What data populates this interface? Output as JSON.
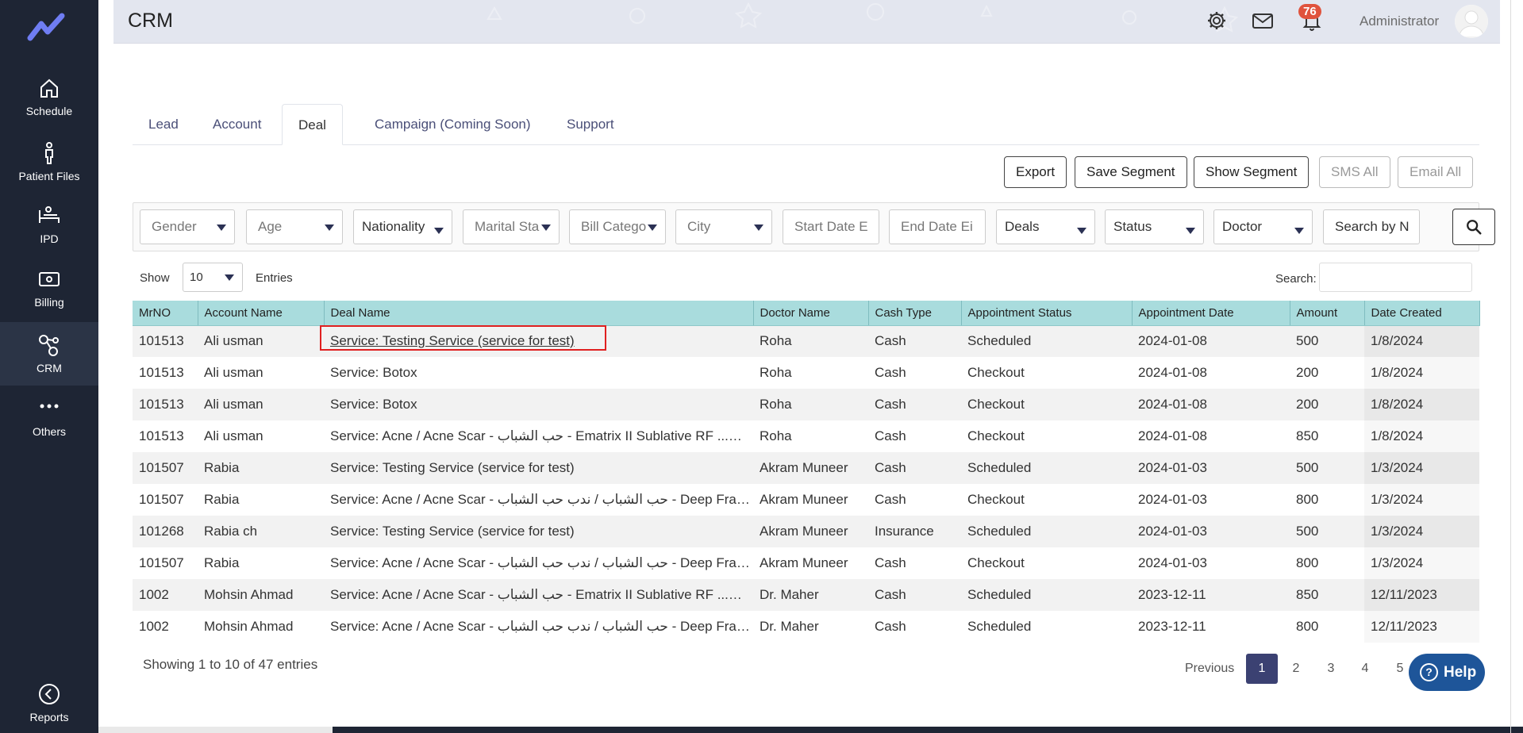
{
  "sidebar": {
    "items": [
      {
        "label": "Schedule",
        "icon": "home-icon"
      },
      {
        "label": "Patient Files",
        "icon": "patient-icon"
      },
      {
        "label": "IPD",
        "icon": "bed-icon"
      },
      {
        "label": "Billing",
        "icon": "money-icon"
      },
      {
        "label": "CRM",
        "icon": "crm-icon",
        "active": true
      },
      {
        "label": "Others",
        "icon": "more-icon"
      },
      {
        "label": "Reports",
        "icon": "reports-icon"
      }
    ]
  },
  "header": {
    "title": "CRM",
    "notification_count": "76",
    "user": "Administrator"
  },
  "tabs": [
    "Lead",
    "Account",
    "Deal",
    "Campaign (Coming Soon)",
    "Support"
  ],
  "active_tab": "Deal",
  "actions": {
    "export": "Export",
    "save_segment": "Save Segment",
    "show_segment": "Show Segment",
    "sms_all": "SMS All",
    "email_all": "Email All"
  },
  "filters": {
    "gender": "Gender",
    "age": "Age",
    "nationality": "Nationality",
    "marital_status": "Marital Sta",
    "bill_category": "Bill Catego",
    "city": "City",
    "start_date": "Start Date E",
    "end_date": "End Date Ei",
    "deals": "Deals",
    "status": "Status",
    "doctor": "Doctor",
    "search_placeholder": "Search by N"
  },
  "list_controls": {
    "show_label": "Show",
    "page_size": "10",
    "entries_label": "Entries",
    "search_label": "Search:"
  },
  "table": {
    "columns": [
      "MrNO",
      "Account Name",
      "Deal Name",
      "Doctor Name",
      "Cash Type",
      "Appointment Status",
      "Appointment Date",
      "Amount",
      "Date Created"
    ],
    "rows": [
      [
        "101513",
        "Ali usman",
        "Service: Testing Service (service for test)",
        "Roha",
        "Cash",
        "Scheduled",
        "2024-01-08",
        "500",
        "1/8/2024"
      ],
      [
        "101513",
        "Ali usman",
        "Service: Botox",
        "Roha",
        "Cash",
        "Checkout",
        "2024-01-08",
        "200",
        "1/8/2024"
      ],
      [
        "101513",
        "Ali usman",
        "Service: Botox",
        "Roha",
        "Cash",
        "Checkout",
        "2024-01-08",
        "200",
        "1/8/2024"
      ],
      [
        "101513",
        "Ali usman",
        "Service: Acne / Acne Scar - حب الشباب - Ematrix II Sublative RF ...طحي",
        "Roha",
        "Cash",
        "Checkout",
        "2024-01-08",
        "850",
        "1/8/2024"
      ],
      [
        "101507",
        "Rabia",
        "Service: Testing Service (service for test)",
        "Akram Muneer",
        "Cash",
        "Scheduled",
        "2024-01-03",
        "500",
        "1/3/2024"
      ],
      [
        "101507",
        "Rabia",
        "Service: Acne / Acne Scar - حب الشباب / ندب حب الشباب - Deep Fraction...",
        "Akram Muneer",
        "Cash",
        "Checkout",
        "2024-01-03",
        "800",
        "1/3/2024"
      ],
      [
        "101268",
        "Rabia ch",
        "Service: Testing Service (service for test)",
        "Akram Muneer",
        "Insurance",
        "Scheduled",
        "2024-01-03",
        "500",
        "1/3/2024"
      ],
      [
        "101507",
        "Rabia",
        "Service: Acne / Acne Scar - حب الشباب / ندب حب الشباب - Deep Fraction...",
        "Akram Muneer",
        "Cash",
        "Checkout",
        "2024-01-03",
        "800",
        "1/3/2024"
      ],
      [
        "1002",
        "Mohsin Ahmad",
        "Service: Acne / Acne Scar - حب الشباب - Ematrix II Sublative RF ...طحي",
        "Dr. Maher",
        "Cash",
        "Scheduled",
        "2023-12-11",
        "850",
        "12/11/2023"
      ],
      [
        "1002",
        "Mohsin Ahmad",
        "Service: Acne / Acne Scar - حب الشباب / ندب حب الشباب - Deep Fraction...",
        "Dr. Maher",
        "Cash",
        "Scheduled",
        "2023-12-11",
        "800",
        "12/11/2023"
      ]
    ]
  },
  "footer": {
    "showing": "Showing 1 to 10 of 47 entries",
    "previous": "Previous",
    "pages": [
      "1",
      "2",
      "3",
      "4",
      "5"
    ],
    "help": "Help"
  },
  "colors": {
    "sidebar": "#1e2534",
    "table_header": "#a9dcdd",
    "active_page": "#3b4172",
    "help_button": "#1e5599",
    "badge": "#e0533d",
    "highlight": "#e02020"
  }
}
